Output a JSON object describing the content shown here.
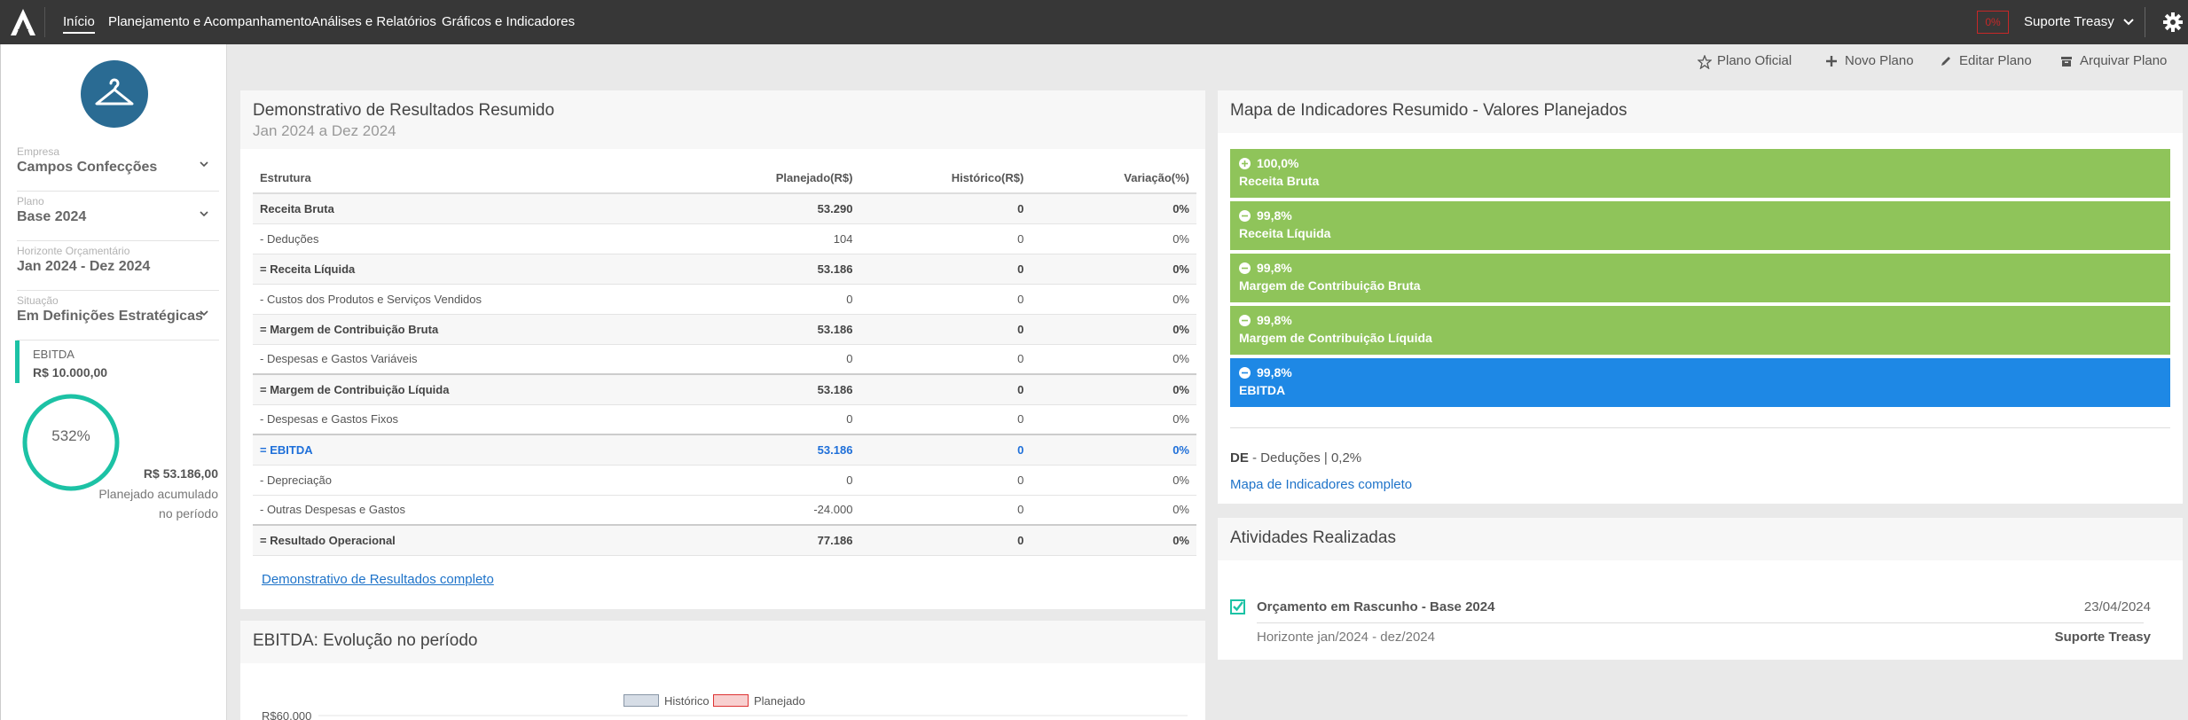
{
  "nav": {
    "items": [
      "Início",
      "Planejamento e Acompanhamento",
      "Análises e Relatórios",
      "Gráficos e Indicadores"
    ],
    "active_index": 0,
    "warning_badge": "0%",
    "user_name": "Suporte Treasy"
  },
  "sidebar": {
    "company_label": "Empresa",
    "company_value": "Campos Confecções",
    "plan_label": "Plano",
    "plan_value": "Base 2024",
    "horizon_label": "Horizonte Orçamentário",
    "horizon_value": "Jan 2024 - Dez 2024",
    "status_label": "Situação",
    "status_value": "Em Definições Estratégicas",
    "kpi_name": "EBITDA",
    "kpi_target": "R$ 10.000,00",
    "kpi_percent": "532%",
    "kpi_gauge_fill": 1.0,
    "accumulated_value": "R$ 53.186,00",
    "accumulated_label": "Planejado acumulado no período"
  },
  "actions": {
    "official_plan": "Plano Oficial",
    "new_plan": "Novo Plano",
    "edit_plan": "Editar Plano",
    "archive_plan": "Arquivar Plano"
  },
  "dre": {
    "title": "Demonstrativo de Resultados Resumido",
    "subtitle": "Jan 2024 a Dez 2024",
    "headers": [
      "Estrutura",
      "Planejado(R$)",
      "Histórico(R$)",
      "Variação(%)"
    ],
    "rows": [
      {
        "name": "Receita Bruta",
        "planned": "53.290",
        "historic": "0",
        "variation": "0%",
        "style": "bold shade"
      },
      {
        "name": "- Deduções",
        "planned": "104",
        "historic": "0",
        "variation": "0%",
        "style": ""
      },
      {
        "name": "= Receita Líquida",
        "planned": "53.186",
        "historic": "0",
        "variation": "0%",
        "style": "bold shade"
      },
      {
        "name": "- Custos dos Produtos e Serviços Vendidos",
        "planned": "0",
        "historic": "0",
        "variation": "0%",
        "style": ""
      },
      {
        "name": "= Margem de Contribuição Bruta",
        "planned": "53.186",
        "historic": "0",
        "variation": "0%",
        "style": "bold shade"
      },
      {
        "name": "- Despesas e Gastos Variáveis",
        "planned": "0",
        "historic": "0",
        "variation": "0%",
        "style": ""
      },
      {
        "name": "= Margem de Contribuição Líquida",
        "planned": "53.186",
        "historic": "0",
        "variation": "0%",
        "style": "bold shade topline"
      },
      {
        "name": "- Despesas e Gastos Fixos",
        "planned": "0",
        "historic": "0",
        "variation": "0%",
        "style": ""
      },
      {
        "name": "= EBITDA",
        "planned": "53.186",
        "historic": "0",
        "variation": "0%",
        "style": "hl shade topline"
      },
      {
        "name": "- Depreciação",
        "planned": "0",
        "historic": "0",
        "variation": "0%",
        "style": ""
      },
      {
        "name": "- Outras Despesas e Gastos",
        "planned": "-24.000",
        "historic": "0",
        "variation": "0%",
        "style": ""
      },
      {
        "name": "= Resultado Operacional",
        "planned": "77.186",
        "historic": "0",
        "variation": "0%",
        "style": "bold shade topline"
      }
    ],
    "link": "Demonstrativo de Resultados completo"
  },
  "ebitda_chart": {
    "title": "EBITDA: Evolução no período",
    "legend_historic": "Histórico",
    "legend_planned": "Planejado",
    "y_top_label": "R$60.000",
    "color_historic": "#d6dde6",
    "color_planned": "#f8d0d0"
  },
  "indicator_map": {
    "title": "Mapa de Indicadores Resumido - Valores Planejados",
    "items": [
      {
        "percent": "100,0%",
        "name": "Receita Bruta",
        "icon": "plus-circle-icon",
        "color": "#8fc45a"
      },
      {
        "percent": "99,8%",
        "name": "Receita Líquida",
        "icon": "minus-circle-icon",
        "color": "#8fc45a"
      },
      {
        "percent": "99,8%",
        "name": "Margem de Contribuição Bruta",
        "icon": "minus-circle-icon",
        "color": "#8fc45a"
      },
      {
        "percent": "99,8%",
        "name": "Margem de Contribuição Líquida",
        "icon": "minus-circle-icon",
        "color": "#8fc45a"
      },
      {
        "percent": "99,8%",
        "name": "EBITDA",
        "icon": "minus-circle-icon",
        "color": "#1e88e5"
      }
    ],
    "de_code": "DE",
    "de_text": " - Deduções | 0,2%",
    "link": "Mapa de Indicadores completo"
  },
  "activities": {
    "title": "Atividades Realizadas",
    "item_title": "Orçamento em Rascunho - Base 2024",
    "item_date": "23/04/2024",
    "item_desc": "Horizonte jan/2024 - dez/2024",
    "item_user": "Suporte Treasy"
  }
}
